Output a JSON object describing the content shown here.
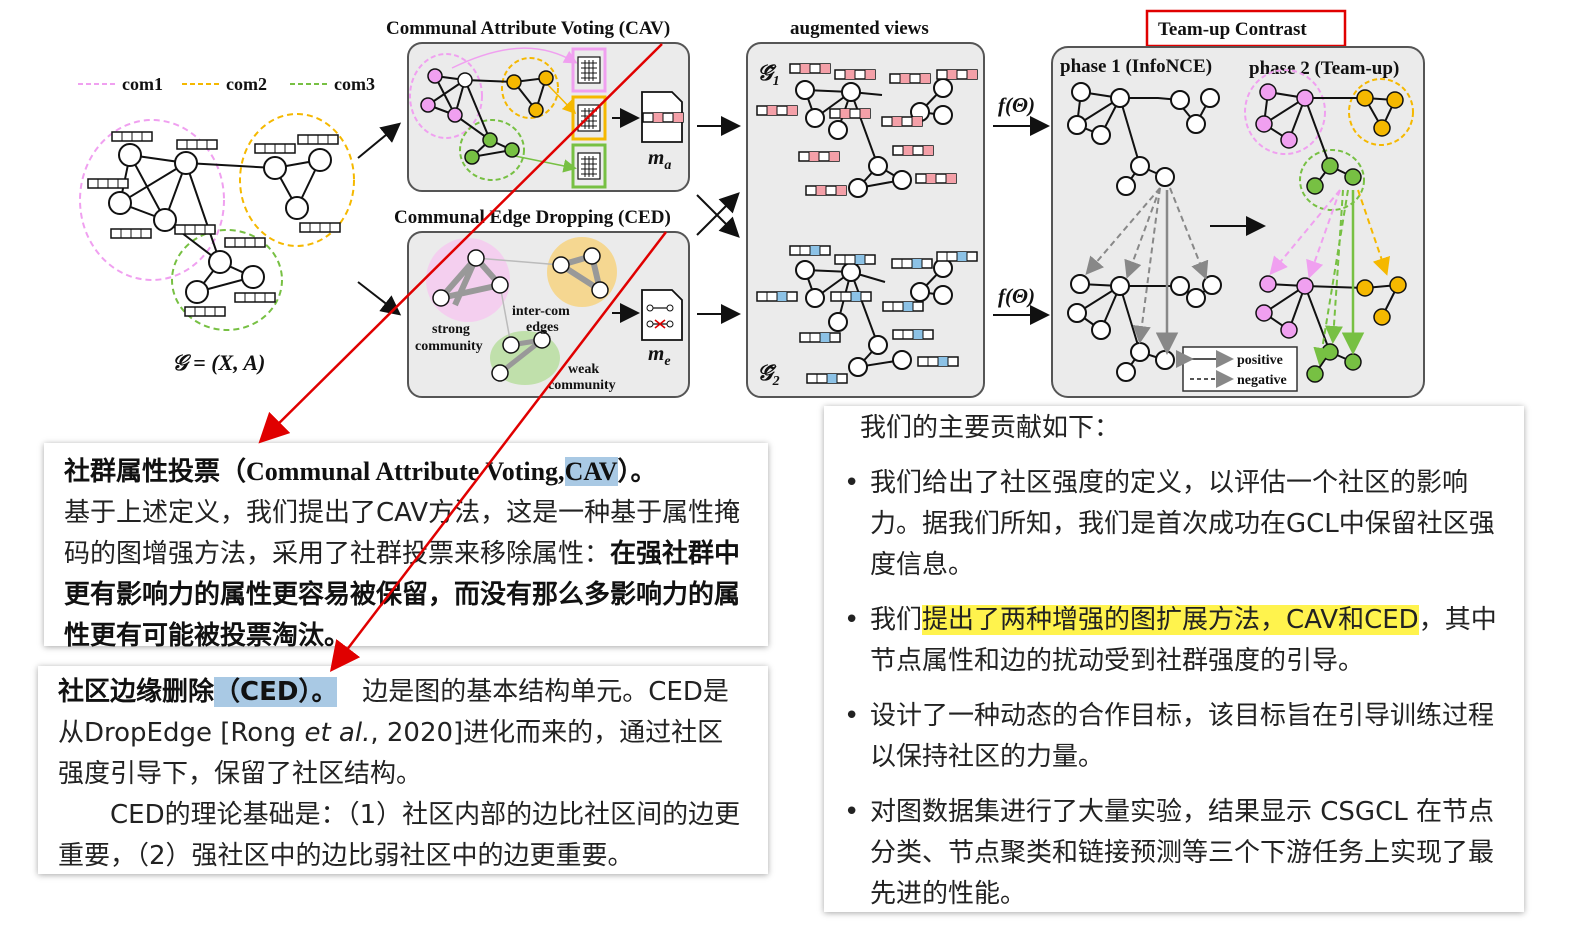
{
  "legend": {
    "com1": "com1",
    "com2": "com2",
    "com3": "com3"
  },
  "titles": {
    "cav": "Communal Attribute Voting (CAV)",
    "ced": "Communal Edge Dropping (CED)",
    "views": "augmented views",
    "teamup": "Team-up Contrast",
    "phase1": "phase 1 (InfoNCE)",
    "phase2": "phase 2 (Team-up)"
  },
  "graph_label": "𝒢 = (X, A)",
  "ma": "m",
  "ma_sub": "a",
  "me": "m",
  "me_sub": "e",
  "g1": "𝒢̃",
  "g1_sub": "1",
  "g2": "𝒢̃",
  "g2_sub": "2",
  "f1": "f(Θ)",
  "f2": "f(Θ)",
  "ced_labels": {
    "strong": "strong",
    "community": "community",
    "inter": "inter-com",
    "edges": "edges",
    "weak": "weak",
    "weak_comm": "community"
  },
  "contrast_legend": {
    "positive": "positive",
    "negative": "negative"
  },
  "colors": {
    "com1": "#f0a0f0",
    "com2": "#f5b800",
    "com3": "#77c043",
    "arrow": "#e00000",
    "teamup_border": "#e00000",
    "hl_blue": "#a9c9e4",
    "hl_yellow": "#fff34d"
  },
  "card_cav": {
    "title_zh": "社群属性投票（",
    "title_en": "Communal  Attribute  Voting,",
    "title_abbr": "CAV",
    "title_end": "）。",
    "body_1": "基于上述定义，我们提出了CAV方法，这是一种基于属性掩码的图增强方法，采用了社群投票来移除属性：",
    "body_2": "在强社群中更有影响力的属性更容易被保留，而没有那么多影响力的属性更有可能被投票淘汰。"
  },
  "card_ced": {
    "title_zh": "社区边缘删除",
    "title_abbr": "（CED）。",
    "body_1": "边是图的基本结构单元。CED是从DropEdge [Rong ",
    "body_etal": "et al.",
    "body_1b": ", 2020]进化而来的，通过社区强度引导下，保留了社区结构。",
    "body_2": "CED的理论基础是：（1）社区内部的边比社区间的边更重要，（2）强社区中的边比弱社区中的边更重要。"
  },
  "card_contrib": {
    "heading": "我们的主要贡献如下：",
    "item1": "我们给出了社区强度的定义，以评估一个社区的影响力。据我们所知，我们是首次成功在GCL中保留社区强度信息。",
    "item2_pre": "我们",
    "item2_hl": "提出了两种增强的图扩展方法，CAV和CED",
    "item2_post": "，其中节点属性和边的扰动受到社群强度的引导。",
    "item3": "设计了一种动态的合作目标，该目标旨在引导训练过程以保持社区的力量。",
    "item4": "对图数据集进行了大量实验，结果显示 CSGCL 在节点分类、节点聚类和链接预测等三个下游任务上实现了最先进的性能。"
  }
}
